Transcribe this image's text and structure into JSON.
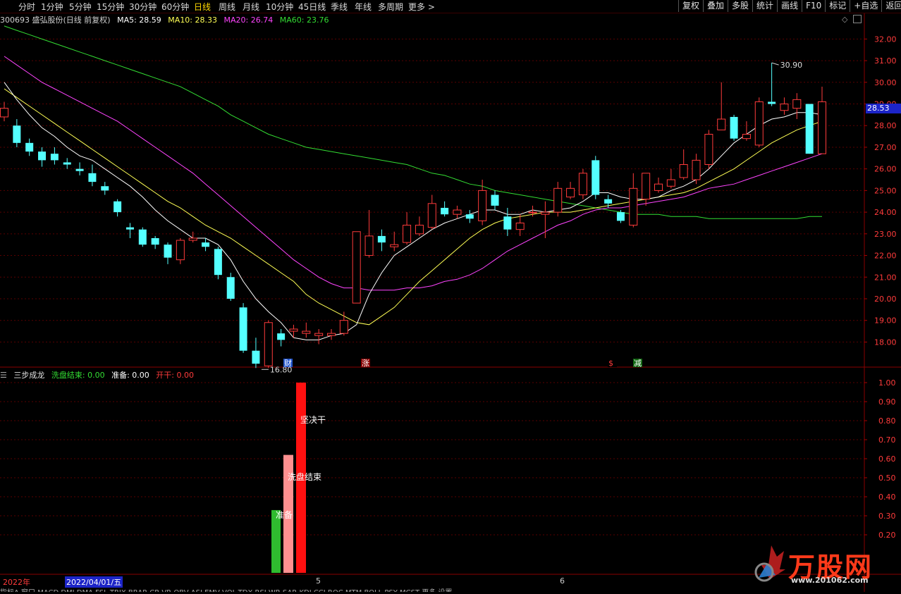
{
  "toolbar": {
    "periods": [
      "分时",
      "1分钟",
      "5分钟",
      "15分钟",
      "30分钟",
      "60分钟",
      "日线",
      "周线",
      "月线",
      "10分钟",
      "45日线",
      "季线",
      "年线",
      "多周期",
      "更多 >"
    ],
    "active_period": "日线",
    "right_buttons": [
      "复权",
      "叠加",
      "多股",
      "统计",
      "画线",
      "F10",
      "标记",
      "+自选",
      "返回"
    ]
  },
  "info": {
    "code_name": "300693 盛弘股份(日线 前复权)",
    "ma5": "MA5: 28.59",
    "ma10": "MA10: 28.33",
    "ma20": "MA20: 26.74",
    "ma60": "MA60: 23.76"
  },
  "colors": {
    "up": "#ff3b3b",
    "down": "#54ffff",
    "ma5": "#ffffff",
    "ma10": "#ffff55",
    "ma20": "#ff44ff",
    "ma60": "#33dd33",
    "grid": "#5a0000"
  },
  "price_axis": {
    "ticks": [
      "32.00",
      "31.00",
      "30.00",
      "29.00",
      "28.00",
      "27.00",
      "26.00",
      "25.00",
      "24.00",
      "23.00",
      "22.00",
      "21.00",
      "20.00",
      "19.00",
      "18.00"
    ],
    "current": "28.53"
  },
  "annotations": {
    "high": "30.90",
    "low": "16.80",
    "events": [
      "财",
      "涨",
      "$",
      "减"
    ]
  },
  "indicator": {
    "name": "三步成龙",
    "wash": "洗盘结束: 0.00",
    "prepare": "准备: 0.00",
    "start": "开干: 0.00",
    "ticks": [
      "1.00",
      "0.90",
      "0.80",
      "0.70",
      "0.60",
      "0.50",
      "0.40",
      "0.30",
      "0.20"
    ],
    "label_decide": "坚决干",
    "label_wash": "洗盘结束",
    "label_prepare": "准备"
  },
  "dates": {
    "year": "2022年",
    "cursor_date": "2022/04/01/五",
    "m5": "5",
    "m6": "6"
  },
  "bottom_tabs": "指标A 窗口 MACD DMI DMA FSL TRIX BRAR CR VR OBV ASI EMV VOL-TDX RSI WR SAR KDJ CCI ROC MTM BOLL PSY MCST 更多 设置",
  "watermark": {
    "brand": "万股网",
    "url": "www.201062.com"
  },
  "chart_data": {
    "type": "candlestick",
    "y_range": [
      17.2,
      32.5
    ],
    "candles": [
      [
        28.4,
        28.8,
        29.1,
        28.2
      ],
      [
        28.0,
        27.2,
        28.3,
        27.0
      ],
      [
        27.2,
        26.8,
        27.4,
        26.6
      ],
      [
        26.8,
        26.4,
        27.0,
        26.1
      ],
      [
        26.7,
        26.4,
        27.0,
        26.2
      ],
      [
        26.3,
        26.2,
        26.5,
        26.0
      ],
      [
        26.0,
        25.9,
        26.3,
        25.7
      ],
      [
        25.8,
        25.4,
        26.2,
        25.2
      ],
      [
        25.2,
        25.0,
        25.4,
        24.8
      ],
      [
        24.5,
        24.0,
        24.6,
        23.8
      ],
      [
        23.3,
        23.2,
        23.5,
        22.8
      ],
      [
        23.2,
        22.5,
        23.3,
        22.4
      ],
      [
        22.8,
        22.5,
        22.9,
        22.3
      ],
      [
        22.5,
        21.9,
        22.6,
        21.6
      ],
      [
        21.8,
        22.7,
        22.8,
        21.6
      ],
      [
        22.7,
        22.8,
        23.1,
        22.6
      ],
      [
        22.6,
        22.4,
        22.8,
        22.2
      ],
      [
        22.3,
        21.1,
        22.4,
        20.9
      ],
      [
        21.0,
        20.0,
        21.2,
        19.9
      ],
      [
        19.6,
        17.6,
        19.8,
        17.5
      ],
      [
        17.6,
        17.0,
        18.2,
        16.8
      ],
      [
        16.9,
        18.9,
        19.0,
        16.8
      ],
      [
        18.4,
        18.1,
        18.6,
        17.8
      ],
      [
        18.5,
        18.6,
        18.8,
        18.2
      ],
      [
        18.4,
        18.5,
        18.9,
        18.2
      ],
      [
        18.3,
        18.4,
        18.6,
        17.9
      ],
      [
        18.3,
        18.4,
        18.6,
        18.1
      ],
      [
        18.4,
        19.0,
        19.4,
        18.3
      ],
      [
        19.8,
        23.1,
        23.1,
        19.8
      ],
      [
        22.0,
        22.9,
        24.1,
        21.9
      ],
      [
        22.9,
        22.6,
        23.2,
        22.2
      ],
      [
        22.4,
        22.5,
        23.1,
        22.2
      ],
      [
        22.6,
        23.4,
        24.0,
        22.5
      ],
      [
        23.0,
        23.4,
        23.8,
        22.9
      ],
      [
        23.3,
        24.4,
        24.8,
        23.2
      ],
      [
        24.2,
        23.9,
        24.5,
        23.8
      ],
      [
        23.9,
        24.1,
        24.3,
        23.7
      ],
      [
        23.9,
        23.7,
        24.1,
        23.5
      ],
      [
        23.6,
        25.0,
        25.5,
        23.4
      ],
      [
        24.8,
        24.3,
        25.0,
        24.1
      ],
      [
        23.8,
        23.2,
        24.2,
        22.9
      ],
      [
        23.2,
        23.5,
        23.9,
        22.9
      ],
      [
        24.0,
        24.0,
        24.3,
        23.8
      ],
      [
        23.9,
        24.0,
        24.5,
        22.8
      ],
      [
        24.0,
        25.1,
        25.4,
        23.8
      ],
      [
        24.7,
        25.1,
        25.4,
        24.6
      ],
      [
        24.8,
        25.8,
        26.0,
        24.6
      ],
      [
        26.4,
        24.8,
        26.6,
        24.6
      ],
      [
        24.6,
        24.4,
        24.8,
        24.2
      ],
      [
        24.0,
        23.6,
        24.1,
        23.5
      ],
      [
        23.4,
        25.1,
        25.8,
        23.3
      ],
      [
        24.6,
        25.8,
        25.8,
        24.3
      ],
      [
        25.0,
        25.3,
        25.6,
        24.9
      ],
      [
        25.2,
        25.5,
        26.0,
        25.1
      ],
      [
        25.6,
        26.2,
        26.9,
        25.5
      ],
      [
        25.5,
        26.4,
        26.7,
        25.3
      ],
      [
        26.2,
        27.6,
        27.8,
        26.0
      ],
      [
        27.8,
        28.3,
        30.0,
        27.8
      ],
      [
        28.4,
        27.4,
        28.5,
        27.3
      ],
      [
        27.4,
        27.6,
        28.2,
        27.3
      ],
      [
        27.1,
        29.1,
        29.3,
        27.0
      ],
      [
        29.1,
        29.0,
        30.9,
        28.9
      ],
      [
        28.7,
        29.0,
        29.3,
        28.5
      ],
      [
        28.8,
        29.2,
        29.5,
        28.3
      ],
      [
        29.0,
        26.7,
        29.0,
        26.7
      ],
      [
        26.7,
        29.1,
        29.8,
        26.7
      ]
    ],
    "ma5": [
      30.0,
      29.2,
      28.5,
      27.9,
      27.5,
      27.0,
      26.6,
      26.4,
      26.0,
      25.6,
      25.2,
      24.7,
      24.1,
      23.6,
      23.2,
      22.8,
      22.8,
      22.5,
      21.8,
      20.8,
      20.0,
      19.4,
      18.9,
      18.2,
      18.1,
      18.1,
      18.3,
      18.4,
      18.8,
      20.2,
      21.2,
      22.0,
      22.4,
      22.8,
      23.2,
      23.5,
      23.7,
      23.9,
      24.1,
      24.1,
      23.9,
      23.9,
      24.1,
      24.0,
      24.1,
      24.2,
      24.5,
      24.9,
      24.9,
      24.7,
      24.6,
      24.6,
      24.7,
      25.0,
      25.2,
      25.5,
      26.0,
      26.6,
      27.2,
      27.6,
      28.0,
      28.3,
      28.4,
      28.6,
      28.6,
      28.5
    ],
    "ma10": [
      29.7,
      29.3,
      28.9,
      28.5,
      28.1,
      27.7,
      27.3,
      26.9,
      26.5,
      26.1,
      25.7,
      25.3,
      24.9,
      24.5,
      24.2,
      23.8,
      23.4,
      23.1,
      22.8,
      22.4,
      22.0,
      21.6,
      21.2,
      20.8,
      20.2,
      19.8,
      19.5,
      19.2,
      18.9,
      18.8,
      19.2,
      19.6,
      20.2,
      20.8,
      21.3,
      21.8,
      22.3,
      22.8,
      23.2,
      23.5,
      23.7,
      23.8,
      23.9,
      24.0,
      24.0,
      24.0,
      24.1,
      24.2,
      24.3,
      24.4,
      24.5,
      24.6,
      24.7,
      24.8,
      24.9,
      25.1,
      25.4,
      25.7,
      26.0,
      26.4,
      26.8,
      27.2,
      27.5,
      27.8,
      28.0,
      28.2
    ],
    "ma20": [
      31.2,
      30.8,
      30.4,
      30.0,
      29.7,
      29.4,
      29.1,
      28.8,
      28.5,
      28.2,
      27.8,
      27.4,
      27.0,
      26.6,
      26.2,
      25.8,
      25.3,
      24.8,
      24.3,
      23.8,
      23.3,
      22.8,
      22.3,
      21.8,
      21.4,
      21.0,
      20.7,
      20.5,
      20.5,
      20.4,
      20.4,
      20.4,
      20.5,
      20.5,
      20.6,
      20.8,
      20.9,
      21.1,
      21.4,
      21.8,
      22.2,
      22.5,
      22.8,
      23.1,
      23.4,
      23.6,
      23.9,
      24.1,
      24.2,
      24.2,
      24.3,
      24.4,
      24.5,
      24.6,
      24.7,
      24.9,
      25.1,
      25.2,
      25.3,
      25.5,
      25.7,
      25.9,
      26.1,
      26.3,
      26.5,
      26.7
    ],
    "ma60": [
      32.6,
      32.4,
      32.2,
      32.0,
      31.8,
      31.6,
      31.4,
      31.2,
      31.0,
      30.8,
      30.6,
      30.4,
      30.2,
      30.0,
      29.8,
      29.5,
      29.2,
      28.9,
      28.5,
      28.2,
      27.9,
      27.6,
      27.4,
      27.2,
      27.0,
      26.9,
      26.8,
      26.7,
      26.6,
      26.5,
      26.4,
      26.3,
      26.2,
      26.0,
      25.8,
      25.7,
      25.5,
      25.3,
      25.2,
      25.0,
      24.9,
      24.8,
      24.7,
      24.6,
      24.5,
      24.4,
      24.3,
      24.2,
      24.1,
      24.0,
      23.9,
      23.9,
      23.9,
      23.8,
      23.8,
      23.8,
      23.7,
      23.7,
      23.7,
      23.7,
      23.7,
      23.7,
      23.7,
      23.7,
      23.8,
      23.8
    ],
    "indicator_bars": [
      {
        "series": "准备",
        "value": 0.33,
        "color": "#2fbb2f"
      },
      {
        "series": "洗盘结束",
        "value": 0.62,
        "color": "#ff9090"
      },
      {
        "series": "开干",
        "value": 1.0,
        "color": "#ff1010"
      }
    ]
  }
}
